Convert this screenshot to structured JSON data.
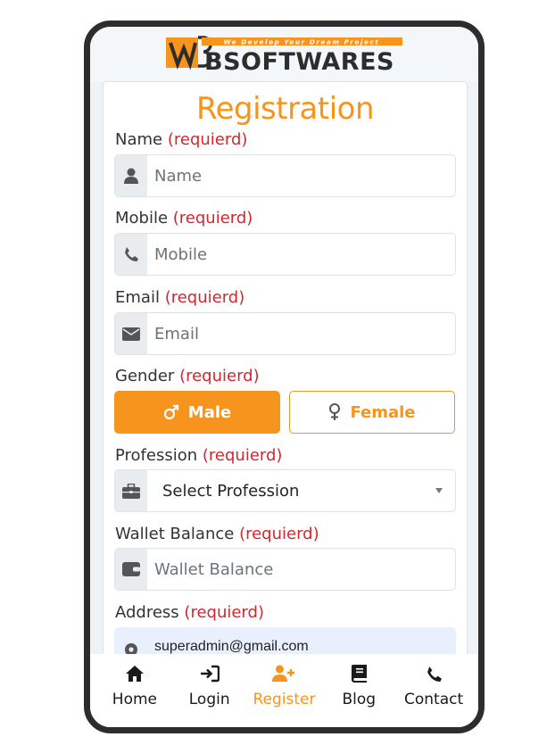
{
  "brand": {
    "tagline": "We Develop Your Dream Project",
    "name": "BSOFTWARES"
  },
  "form": {
    "title": "Registration",
    "required_mark": "(requierd)",
    "name": {
      "label": "Name",
      "placeholder": "Name",
      "icon": "user-icon"
    },
    "mobile": {
      "label": "Mobile",
      "placeholder": "Mobile",
      "icon": "phone-icon"
    },
    "email": {
      "label": "Email",
      "placeholder": "Email",
      "icon": "envelope-icon"
    },
    "gender": {
      "label": "Gender",
      "male": "Male",
      "female": "Female",
      "selected": "Male"
    },
    "profession": {
      "label": "Profession",
      "value": "Select Profession",
      "icon": "briefcase-icon"
    },
    "wallet": {
      "label": "Wallet Balance",
      "placeholder": "Wallet Balance",
      "icon": "wallet-icon"
    },
    "address": {
      "label": "Address",
      "value": "superadmin@gmail.com",
      "icon": "map-marker-icon"
    }
  },
  "nav": [
    {
      "label": "Home",
      "icon": "home-icon",
      "active": false
    },
    {
      "label": "Login",
      "icon": "sign-in-icon",
      "active": false
    },
    {
      "label": "Register",
      "icon": "user-plus-icon",
      "active": true
    },
    {
      "label": "Blog",
      "icon": "book-icon",
      "active": false
    },
    {
      "label": "Contact",
      "icon": "phone-icon",
      "active": false
    }
  ],
  "colors": {
    "accent": "#f7941d",
    "required": "#d0282e",
    "frame": "#2d2d2d",
    "autofill": "#e8f0fe"
  }
}
